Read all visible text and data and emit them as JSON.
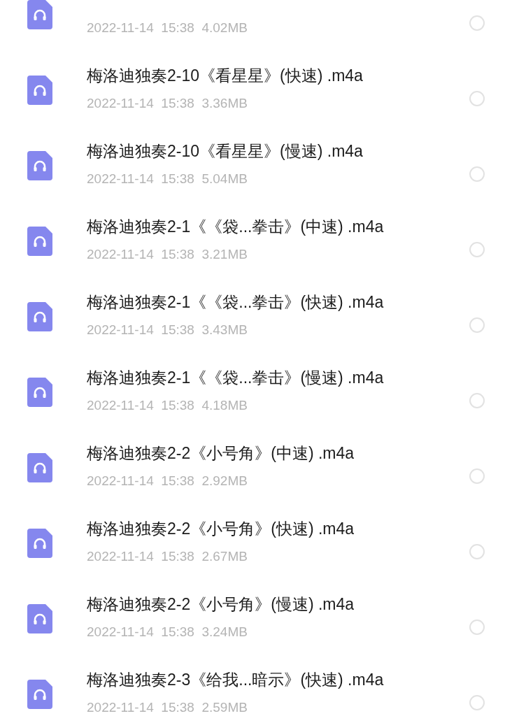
{
  "files": [
    {
      "meta": "2022-11-14  15:38  4.02MB",
      "selected": false
    },
    {
      "name": "梅洛迪独奏2-10《看星星》(快速) .m4a",
      "meta": "2022-11-14  15:38  3.36MB",
      "selected": false
    },
    {
      "name": "梅洛迪独奏2-10《看星星》(慢速) .m4a",
      "meta": "2022-11-14  15:38  5.04MB",
      "selected": false
    },
    {
      "name": "梅洛迪独奏2-1《《袋...拳击》(中速) .m4a",
      "meta": "2022-11-14  15:38  3.21MB",
      "selected": false
    },
    {
      "name": "梅洛迪独奏2-1《《袋...拳击》(快速) .m4a",
      "meta": "2022-11-14  15:38  3.43MB",
      "selected": false
    },
    {
      "name": "梅洛迪独奏2-1《《袋...拳击》(慢速) .m4a",
      "meta": "2022-11-14  15:38  4.18MB",
      "selected": false
    },
    {
      "name": "梅洛迪独奏2-2《小号角》(中速) .m4a",
      "meta": "2022-11-14  15:38  2.92MB",
      "selected": false
    },
    {
      "name": "梅洛迪独奏2-2《小号角》(快速) .m4a",
      "meta": "2022-11-14  15:38  2.67MB",
      "selected": false
    },
    {
      "name": "梅洛迪独奏2-2《小号角》(慢速) .m4a",
      "meta": "2022-11-14  15:38  3.24MB",
      "selected": false
    },
    {
      "name": "梅洛迪独奏2-3《给我...暗示》(快速) .m4a",
      "meta": "2022-11-14  15:38  2.59MB",
      "selected": false
    }
  ]
}
